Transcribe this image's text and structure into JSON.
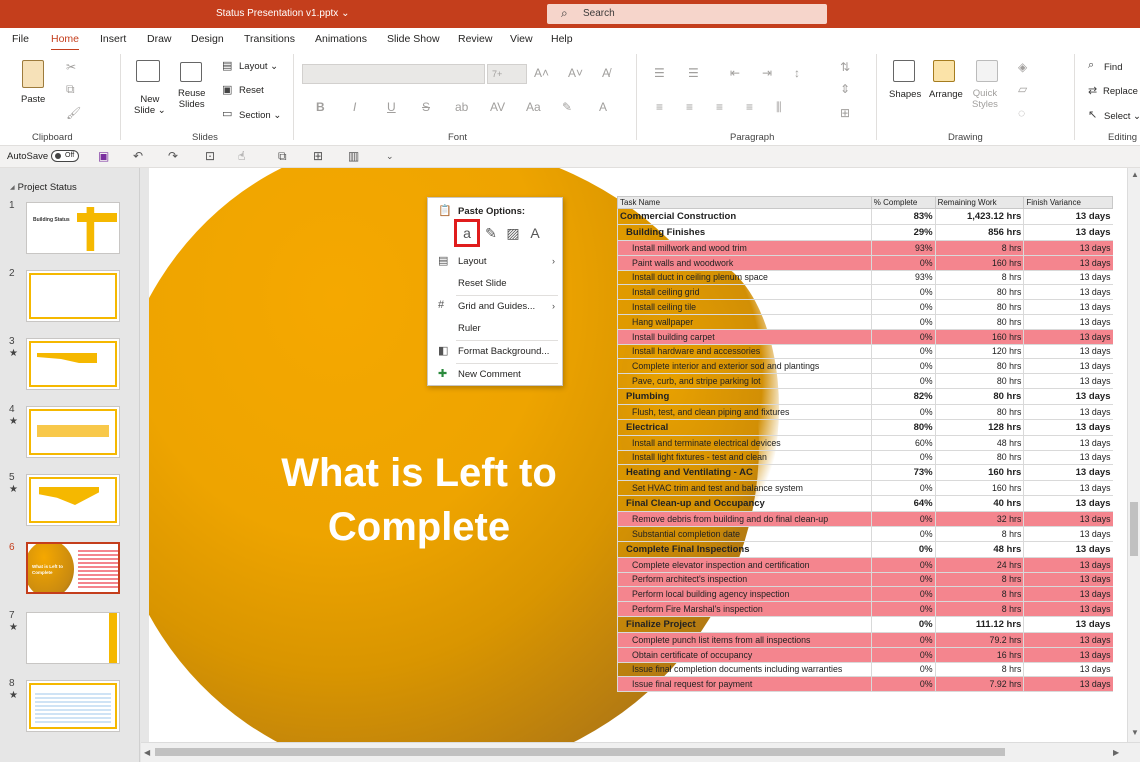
{
  "title_bar": {
    "doc_title": "Status Presentation v1.pptx ⌄",
    "search_placeholder": "Search"
  },
  "tabs": [
    "File",
    "Home",
    "Insert",
    "Draw",
    "Design",
    "Transitions",
    "Animations",
    "Slide Show",
    "Review",
    "View",
    "Help"
  ],
  "ribbon": {
    "clipboard": {
      "paste": "Paste",
      "label": "Clipboard"
    },
    "slides": {
      "new_slide": "New\nSlide ⌄",
      "reuse_slides": "Reuse\nSlides",
      "layout": "Layout ⌄",
      "reset": "Reset",
      "section": "Section ⌄",
      "label": "Slides"
    },
    "font": {
      "font_size": "7+",
      "bold": "B",
      "italic": "I",
      "underline": "U",
      "strike": "S",
      "label": "Font"
    },
    "paragraph": {
      "label": "Paragraph"
    },
    "drawing": {
      "shapes": "Shapes",
      "arrange": "Arrange",
      "quick_styles": "Quick\nStyles",
      "label": "Drawing"
    },
    "editing": {
      "find": "Find",
      "replace": "Replace",
      "select": "Select ⌄",
      "label": "Editing"
    }
  },
  "qat": {
    "autosave": "AutoSave",
    "toggle": "Off"
  },
  "thumbnails": {
    "section": "Project Status",
    "slides": [
      {
        "num": "1",
        "star": "",
        "title": "Building Status"
      },
      {
        "num": "2",
        "star": "",
        "title": ""
      },
      {
        "num": "3",
        "star": "★",
        "title": ""
      },
      {
        "num": "4",
        "star": "★",
        "title": ""
      },
      {
        "num": "5",
        "star": "★",
        "title": ""
      },
      {
        "num": "6",
        "star": "",
        "title": "What is Left to Complete"
      },
      {
        "num": "7",
        "star": "★",
        "title": ""
      },
      {
        "num": "8",
        "star": "★",
        "title": ""
      }
    ]
  },
  "slide": {
    "title_line1": "What is Left to",
    "title_line2": "Complete",
    "table": {
      "headers": [
        "Task Name",
        "% Complete",
        "Remaining Work",
        "Finish Variance"
      ],
      "rows": [
        {
          "type": "summary",
          "level": 0,
          "red": false,
          "name": "Commercial Construction",
          "pct": "83%",
          "work": "1,423.12 hrs",
          "var": "13 days"
        },
        {
          "type": "summary",
          "level": 1,
          "red": false,
          "name": "Building Finishes",
          "pct": "29%",
          "work": "856 hrs",
          "var": "13 days"
        },
        {
          "type": "task",
          "level": 2,
          "red": true,
          "name": "Install millwork and wood trim",
          "pct": "93%",
          "work": "8 hrs",
          "var": "13 days"
        },
        {
          "type": "task",
          "level": 2,
          "red": true,
          "name": "Paint walls and woodwork",
          "pct": "0%",
          "work": "160 hrs",
          "var": "13 days"
        },
        {
          "type": "task",
          "level": 2,
          "red": false,
          "name": "Install duct in ceiling plenum space",
          "pct": "93%",
          "work": "8 hrs",
          "var": "13 days"
        },
        {
          "type": "task",
          "level": 2,
          "red": false,
          "name": "Install ceiling grid",
          "pct": "0%",
          "work": "80 hrs",
          "var": "13 days"
        },
        {
          "type": "task",
          "level": 2,
          "red": false,
          "name": "Install ceiling tile",
          "pct": "0%",
          "work": "80 hrs",
          "var": "13 days"
        },
        {
          "type": "task",
          "level": 2,
          "red": false,
          "name": "Hang wallpaper",
          "pct": "0%",
          "work": "80 hrs",
          "var": "13 days"
        },
        {
          "type": "task",
          "level": 2,
          "red": true,
          "name": "Install building carpet",
          "pct": "0%",
          "work": "160 hrs",
          "var": "13 days"
        },
        {
          "type": "task",
          "level": 2,
          "red": false,
          "name": "Install hardware and accessories",
          "pct": "0%",
          "work": "120 hrs",
          "var": "13 days"
        },
        {
          "type": "task",
          "level": 2,
          "red": false,
          "name": "Complete interior and exterior sod and plantings",
          "pct": "0%",
          "work": "80 hrs",
          "var": "13 days"
        },
        {
          "type": "task",
          "level": 2,
          "red": false,
          "name": "Pave, curb, and stripe parking lot",
          "pct": "0%",
          "work": "80 hrs",
          "var": "13 days"
        },
        {
          "type": "summary",
          "level": 1,
          "red": false,
          "name": "Plumbing",
          "pct": "82%",
          "work": "80 hrs",
          "var": "13 days"
        },
        {
          "type": "task",
          "level": 2,
          "red": false,
          "name": "Flush, test, and clean piping and fixtures",
          "pct": "0%",
          "work": "80 hrs",
          "var": "13 days"
        },
        {
          "type": "summary",
          "level": 1,
          "red": false,
          "name": "Electrical",
          "pct": "80%",
          "work": "128 hrs",
          "var": "13 days"
        },
        {
          "type": "task",
          "level": 2,
          "red": false,
          "name": "Install and terminate electrical devices",
          "pct": "60%",
          "work": "48 hrs",
          "var": "13 days"
        },
        {
          "type": "task",
          "level": 2,
          "red": false,
          "name": "Install light fixtures - test and clean",
          "pct": "0%",
          "work": "80 hrs",
          "var": "13 days"
        },
        {
          "type": "summary",
          "level": 1,
          "red": false,
          "name": "Heating and Ventilating - AC",
          "pct": "73%",
          "work": "160 hrs",
          "var": "13 days"
        },
        {
          "type": "task",
          "level": 2,
          "red": false,
          "name": "Set HVAC trim and test and balance system",
          "pct": "0%",
          "work": "160 hrs",
          "var": "13 days"
        },
        {
          "type": "summary",
          "level": 1,
          "red": false,
          "name": "Final Clean-up and Occupancy",
          "pct": "64%",
          "work": "40 hrs",
          "var": "13 days"
        },
        {
          "type": "task",
          "level": 2,
          "red": true,
          "name": "Remove debris from building and do final clean-up",
          "pct": "0%",
          "work": "32 hrs",
          "var": "13 days"
        },
        {
          "type": "task",
          "level": 2,
          "red": false,
          "name": "Substantial completion date",
          "pct": "0%",
          "work": "8 hrs",
          "var": "13 days"
        },
        {
          "type": "summary",
          "level": 1,
          "red": false,
          "name": "Complete Final Inspections",
          "pct": "0%",
          "work": "48 hrs",
          "var": "13 days"
        },
        {
          "type": "task",
          "level": 2,
          "red": true,
          "name": "Complete elevator inspection and certification",
          "pct": "0%",
          "work": "24 hrs",
          "var": "13 days"
        },
        {
          "type": "task",
          "level": 2,
          "red": true,
          "name": "Perform architect's inspection",
          "pct": "0%",
          "work": "8 hrs",
          "var": "13 days"
        },
        {
          "type": "task",
          "level": 2,
          "red": true,
          "name": "Perform local building agency inspection",
          "pct": "0%",
          "work": "8 hrs",
          "var": "13 days"
        },
        {
          "type": "task",
          "level": 2,
          "red": true,
          "name": "Perform Fire Marshal's inspection",
          "pct": "0%",
          "work": "8 hrs",
          "var": "13 days"
        },
        {
          "type": "summary",
          "level": 1,
          "red": false,
          "name": "Finalize Project",
          "pct": "0%",
          "work": "111.12 hrs",
          "var": "13 days"
        },
        {
          "type": "task",
          "level": 2,
          "red": true,
          "name": "Complete punch list items from all inspections",
          "pct": "0%",
          "work": "79.2 hrs",
          "var": "13 days"
        },
        {
          "type": "task",
          "level": 2,
          "red": true,
          "name": "Obtain certificate of occupancy",
          "pct": "0%",
          "work": "16 hrs",
          "var": "13 days"
        },
        {
          "type": "task",
          "level": 2,
          "red": false,
          "name": "Issue final completion documents including warranties",
          "pct": "0%",
          "work": "8 hrs",
          "var": "13 days"
        },
        {
          "type": "task",
          "level": 2,
          "red": true,
          "name": "Issue final request for payment",
          "pct": "0%",
          "work": "7.92 hrs",
          "var": "13 days"
        }
      ]
    }
  },
  "context_menu": {
    "header": "Paste Options:",
    "items": [
      {
        "label": "Layout",
        "icon": "layout-icon",
        "submenu": true
      },
      {
        "label": "Reset Slide",
        "icon": "",
        "submenu": false
      },
      {
        "label": "Grid and Guides...",
        "icon": "grid-icon",
        "submenu": true
      },
      {
        "label": "Ruler",
        "icon": "",
        "submenu": false
      },
      {
        "label": "Format Background...",
        "icon": "format-background-icon",
        "submenu": false
      },
      {
        "label": "New Comment",
        "icon": "comment-icon",
        "submenu": false
      }
    ]
  },
  "colors": {
    "accent": "#c43e1c",
    "slide_orange": "#f5a800",
    "row_red": "#f4858e",
    "highlight": "#e01c1c"
  }
}
